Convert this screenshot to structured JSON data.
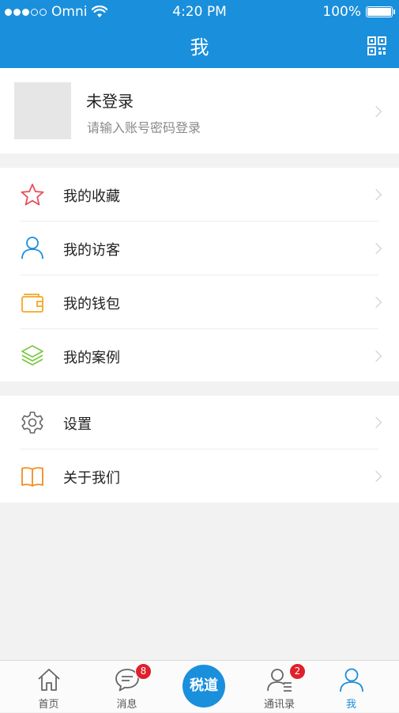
{
  "status_bar": {
    "carrier": "Omni",
    "time": "4:20 PM",
    "battery": "100%",
    "signal_dots_filled": 3,
    "signal_dots_total": 5,
    "battery_level": 1.0
  },
  "header": {
    "title": "我",
    "qr_icon": "qr-code-icon"
  },
  "profile": {
    "name": "未登录",
    "hint": "请输入账号密码登录"
  },
  "menu_group_1": [
    {
      "label": "我的收藏",
      "icon": "star-icon",
      "color": "#e8505b"
    },
    {
      "label": "我的访客",
      "icon": "person-icon",
      "color": "#1a8fdc"
    },
    {
      "label": "我的钱包",
      "icon": "wallet-icon",
      "color": "#f5a623"
    },
    {
      "label": "我的案例",
      "icon": "layers-icon",
      "color": "#7ac943"
    }
  ],
  "menu_group_2": [
    {
      "label": "设置",
      "icon": "gear-icon",
      "color": "#666666"
    },
    {
      "label": "关于我们",
      "icon": "book-icon",
      "color": "#f08c1e"
    }
  ],
  "tabbar": {
    "tabs": [
      {
        "label": "首页",
        "icon": "home-icon"
      },
      {
        "label": "消息",
        "icon": "message-icon",
        "badge": "8"
      },
      {
        "label": "",
        "icon": "center-logo"
      },
      {
        "label": "通讯录",
        "icon": "contacts-icon",
        "badge": "2"
      },
      {
        "label": "我",
        "icon": "person-icon",
        "active": true
      }
    ],
    "center_text": "税道"
  },
  "colors": {
    "primary": "#1a8fdc",
    "badge": "#e0202a"
  }
}
